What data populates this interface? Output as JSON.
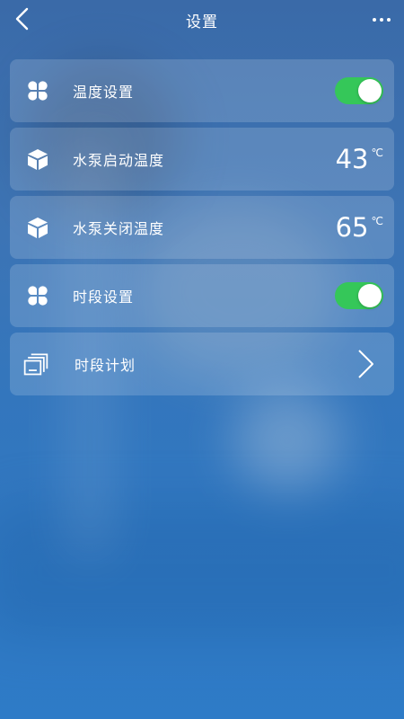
{
  "header": {
    "title": "设置",
    "back_icon": "back-arrow-icon",
    "more_icon": "more-dots-icon"
  },
  "settings": [
    {
      "label": "温度设置",
      "icon": "four-petal-icon",
      "control": "toggle",
      "enabled": true
    },
    {
      "label": "水泵启动温度",
      "icon": "cube-icon",
      "control": "value",
      "value": "43",
      "unit": "℃"
    },
    {
      "label": "水泵关闭温度",
      "icon": "cube-icon",
      "control": "value",
      "value": "65",
      "unit": "℃"
    },
    {
      "label": "时段设置",
      "icon": "four-petal-icon",
      "control": "toggle",
      "enabled": true
    },
    {
      "label": "时段计划",
      "icon": "stacked-windows-icon",
      "control": "chevron"
    }
  ],
  "colors": {
    "toggle_on": "#35c759",
    "background": "#3376bd"
  }
}
